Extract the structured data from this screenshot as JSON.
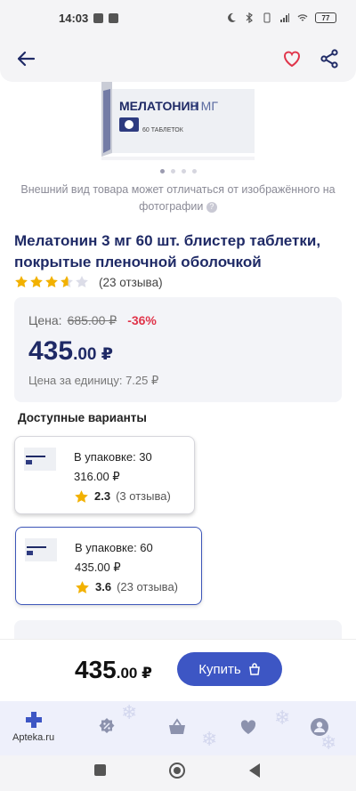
{
  "status_bar": {
    "time": "14:03",
    "battery": "77"
  },
  "product": {
    "package_brand": "МЕЛАТОНИН",
    "package_dose": "3 МГ",
    "package_count": "60 ТАБЛЕТОК",
    "disclaimer": "Внешний вид товара может отличаться от изображённого на фотографии",
    "title": "Мелатонин 3 мг 60 шт. блистер таблетки, покрытые пленочной оболочкой",
    "rating_value": 3.6,
    "rating_max": 5,
    "reviews": "(23 отзыва)"
  },
  "price": {
    "label": "Цена:",
    "old": "685.00 ₽",
    "discount": "-36%",
    "main_int": "435",
    "main_dec": ".00 ₽",
    "unit": "Цена за единицу: 7.25 ₽"
  },
  "variants": {
    "title": "Доступные варианты",
    "items": [
      {
        "pack": "В упаковке: 30",
        "price": "316.00 ₽",
        "rating": "2.3",
        "reviews": "(3 отзыва)"
      },
      {
        "pack": "В упаковке: 60",
        "price": "435.00 ₽",
        "rating": "3.6",
        "reviews": "(23 отзыва)"
      }
    ]
  },
  "buy_bar": {
    "price_int": "435",
    "price_dec": ".00 ₽",
    "button": "Купить"
  },
  "bottom_nav": {
    "home_label": "Apteka.ru"
  },
  "colors": {
    "brand": "#1f2a66",
    "accent": "#3d56c4",
    "discount": "#e0344a",
    "favorite": "#e0344a"
  },
  "icons": [
    "back-arrow-icon",
    "heart-icon",
    "share-icon",
    "help-icon",
    "star-icon",
    "bag-icon",
    "home-cross-icon",
    "percent-icon",
    "basket-icon",
    "heart-nav-icon",
    "profile-icon"
  ]
}
